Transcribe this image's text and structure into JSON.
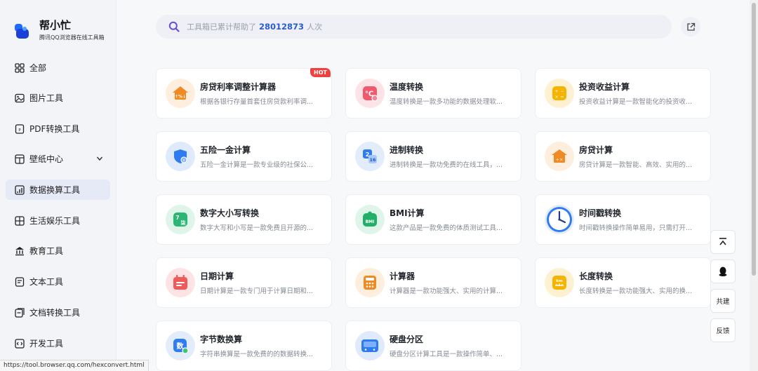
{
  "brand": {
    "name": "帮小忙",
    "subtitle": "腾讯QQ浏览器在线工具箱"
  },
  "sidebar": {
    "items": [
      {
        "label": "全部",
        "icon": "grid-icon"
      },
      {
        "label": "图片工具",
        "icon": "image-icon"
      },
      {
        "label": "PDF转换工具",
        "icon": "pdf-icon"
      },
      {
        "label": "壁纸中心",
        "icon": "wallpaper-icon",
        "expandable": true
      },
      {
        "label": "数据换算工具",
        "icon": "data-icon",
        "active": true
      },
      {
        "label": "生活娱乐工具",
        "icon": "life-icon"
      },
      {
        "label": "教育工具",
        "icon": "education-icon"
      },
      {
        "label": "文本工具",
        "icon": "text-icon"
      },
      {
        "label": "文档转换工具",
        "icon": "document-icon"
      },
      {
        "label": "开发工具",
        "icon": "code-icon"
      }
    ]
  },
  "search": {
    "prefix": "工具箱已累计帮助了",
    "count": "28012873",
    "suffix": "人次"
  },
  "cards": [
    {
      "title": "房贷利率调整计算器",
      "desc": "根据各银行存量首套住房贷款利率调...",
      "badge": "HOT",
      "icon": "house-rate-icon",
      "color": "#f08a24",
      "bg": "#fdeedd"
    },
    {
      "title": "温度转换",
      "desc": "温度转换是一款多功能的数据处理软...",
      "icon": "thermometer-icon",
      "color": "#ef5a6f",
      "bg": "#fde3e6"
    },
    {
      "title": "投资收益计算",
      "desc": "投资收益计算是一款智能化的投资收...",
      "icon": "investment-icon",
      "color": "#f5b400",
      "bg": "#fdf1d2"
    },
    {
      "title": "五险一金计算",
      "desc": "五险一金计算是一款专业级的社保公...",
      "icon": "shield-icon",
      "color": "#2f7bf0",
      "bg": "#dfeafd"
    },
    {
      "title": "进制转换",
      "desc": "进制转换是一款功免费的在线工具，...",
      "icon": "base-convert-icon",
      "color": "#2f7bf0",
      "bg": "#e3ecfb"
    },
    {
      "title": "房贷计算",
      "desc": "房贷计算是一款智能、高效、实用的...",
      "icon": "mortgage-icon",
      "color": "#f08a24",
      "bg": "#fdeedd"
    },
    {
      "title": "数字大小写转换",
      "desc": "数字大写和小写是一款免费且开源的...",
      "icon": "number-case-icon",
      "color": "#2bb673",
      "bg": "#dff5e9"
    },
    {
      "title": "BMI计算",
      "desc": "这款产品是一款免费的体质测试工具...",
      "icon": "bmi-icon",
      "color": "#22b069",
      "bg": "#dff5e9"
    },
    {
      "title": "时间戳转换",
      "desc": "时间戳转换操作简单易用，只需打开...",
      "icon": "clock-icon",
      "color": "#2f7bf0",
      "bg": "#e3ecfb"
    },
    {
      "title": "日期计算",
      "desc": "日期计算是一款专门用于计算日期和...",
      "icon": "calendar-icon",
      "color": "#ef5a5a",
      "bg": "#fde3e3"
    },
    {
      "title": "计算器",
      "desc": "计算器是一款功能强大、实用的计算...",
      "icon": "calculator-icon",
      "color": "#f08a24",
      "bg": "#fdeedd"
    },
    {
      "title": "长度转换",
      "desc": "长度转换是一款功能强大、实用的换...",
      "icon": "ruler-icon",
      "color": "#f5b400",
      "bg": "#fdf1d2"
    },
    {
      "title": "字节数换算",
      "desc": "字符串换算是一款免费的的数据转换...",
      "icon": "byte-icon",
      "color": "#2f7bf0",
      "bg": "#e3ecfb"
    },
    {
      "title": "硬盘分区",
      "desc": "硬盘分区计算工具是一款操作简单、...",
      "icon": "disk-icon",
      "color": "#2f7bf0",
      "bg": "#dfeafd"
    }
  ],
  "floatbar": {
    "top_icon": "back-to-top-icon",
    "qq_icon": "qq-icon",
    "cobuild": "共建",
    "feedback": "反馈"
  },
  "status_url": "https://tool.browser.qq.com/hexconvert.html"
}
